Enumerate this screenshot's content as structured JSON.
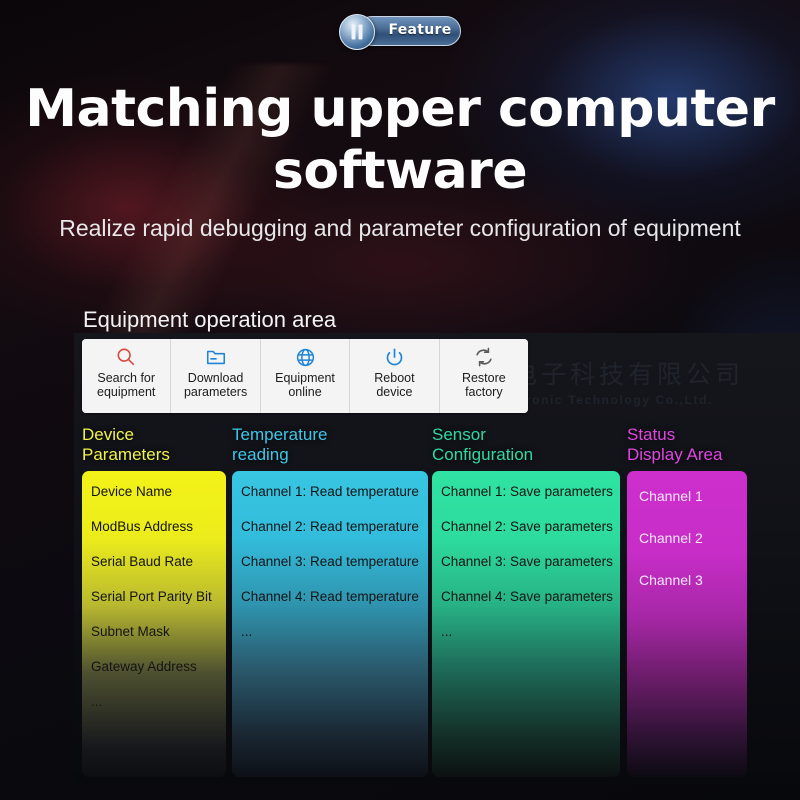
{
  "badge": {
    "label": "Feature",
    "icon": "pause-bars-icon"
  },
  "hero": {
    "title": "Matching upper\ncomputer software",
    "subtitle": "Realize rapid debugging and parameter\nconfiguration of equipment"
  },
  "section": {
    "title": "Equipment operation area"
  },
  "watermark": {
    "cn": "电子科技有限公司",
    "en": "ctronic Technology Co.,Ltd."
  },
  "toolbar": {
    "buttons": [
      {
        "label": "Search for\nequipment",
        "icon": "search-icon",
        "color": "#d9483c"
      },
      {
        "label": "Download\nparameters",
        "icon": "folder-icon",
        "color": "#1e84d8"
      },
      {
        "label": "Equipment\nonline",
        "icon": "globe-icon",
        "color": "#1e84d8"
      },
      {
        "label": "Reboot\ndevice",
        "icon": "power-icon",
        "color": "#1e84d8"
      },
      {
        "label": "Restore\nfactory",
        "icon": "refresh-icon",
        "color": "#5a5a5a"
      }
    ]
  },
  "columns": [
    {
      "heading": "Device\nParameters",
      "heading_color": "#f2f24a",
      "panel_color": "#f3f318",
      "items": [
        "Device Name",
        "ModBus Address",
        "Serial Baud Rate",
        "Serial Port Parity Bit",
        "Subnet Mask",
        "Gateway Address",
        "..."
      ]
    },
    {
      "heading": "Temperature\nreading",
      "heading_color": "#3fc6e8",
      "panel_color": "#37c6e2",
      "items": [
        "Channel 1: Read temperature",
        "Channel 2: Read temperature",
        "Channel 3: Read temperature",
        "Channel 4: Read temperature",
        "..."
      ]
    },
    {
      "heading": "Sensor\nConfiguration",
      "heading_color": "#2fd9a0",
      "panel_color": "#2fe3a3",
      "items": [
        "Channel 1: Save parameters",
        "Channel 2: Save parameters",
        "Channel 3: Save parameters",
        "Channel 4: Save parameters",
        "..."
      ]
    },
    {
      "heading": "Status\nDisplay Area",
      "heading_color": "#e046e0",
      "panel_color": "#cd2fcd",
      "items": [
        "Channel 1",
        "Channel 2",
        "Channel 3"
      ]
    }
  ]
}
